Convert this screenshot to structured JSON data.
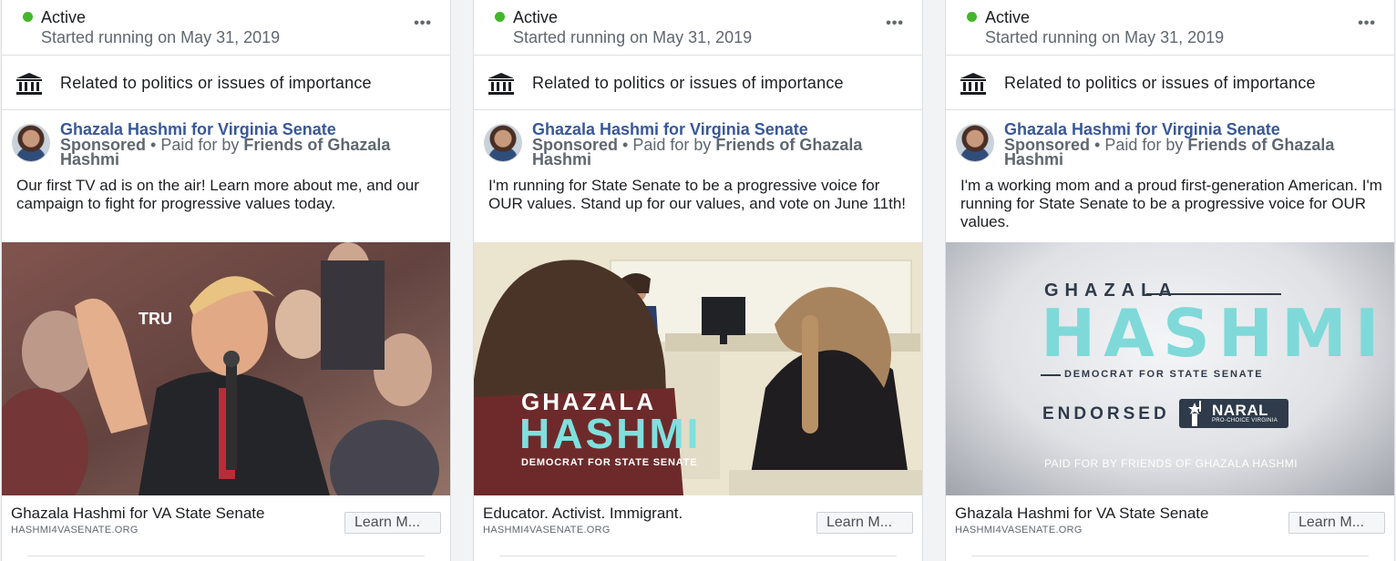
{
  "cards": [
    {
      "status": "Active",
      "started": "Started running on May 31, 2019",
      "more": "•••",
      "category": "Related to politics or issues of importance",
      "page_name": "Ghazala Hashmi for Virginia Senate",
      "sponsored": "Sponsored",
      "paid_prefix": " • Paid for by ",
      "paid_by": "Friends of Ghazala Hashmi",
      "body": "Our first TV ad is on the air! Learn more about me, and our campaign to fight for progressive values today.",
      "footer_title": "Ghazala Hashmi for VA State Senate",
      "footer_domain": "HASHMI4VASENATE.ORG",
      "cta": "Learn M...",
      "media_sign": "TRU"
    },
    {
      "status": "Active",
      "started": "Started running on May 31, 2019",
      "more": "•••",
      "category": "Related to politics or issues of importance",
      "page_name": "Ghazala Hashmi for Virginia Senate",
      "sponsored": "Sponsored",
      "paid_prefix": " • Paid for by ",
      "paid_by": "Friends of Ghazala Hashmi",
      "body": "I'm running for State Senate to be a progressive voice for OUR values. Stand up for our values, and vote on June 11th!",
      "footer_title": "Educator. Activist. Immigrant.",
      "footer_domain": "HASHMI4VASENATE.ORG",
      "cta": "Learn M...",
      "overlay_first": "GHAZALA",
      "overlay_last": "HASHMI",
      "overlay_sub": "DEMOCRAT FOR STATE SENATE"
    },
    {
      "status": "Active",
      "started": "Started running on May 31, 2019",
      "more": "•••",
      "category": "Related to politics or issues of importance",
      "page_name": "Ghazala Hashmi for Virginia Senate",
      "sponsored": "Sponsored",
      "paid_prefix": " • Paid for by ",
      "paid_by": "Friends of Ghazala Hashmi",
      "body": "I'm a working mom and a proud first-generation American. I'm running for State Senate to be a progressive voice for OUR values.",
      "footer_title": "Ghazala Hashmi for VA State Senate",
      "footer_domain": "HASHMI4VASENATE.ORG",
      "cta": "Learn M...",
      "graphic": {
        "first": "GHAZALA",
        "last": "HASHMI",
        "sub": "DEMOCRAT FOR STATE SENATE",
        "endorsed": "ENDORSED BY",
        "naral": "NARAL",
        "naral_sub": "PRO-CHOICE VIRGINIA",
        "paid": "PAID FOR BY FRIENDS OF GHAZALA HASHMI"
      }
    }
  ],
  "colors": {
    "active_dot": "#42b72a",
    "link": "#385898",
    "accent_teal": "#7fd9d9"
  }
}
